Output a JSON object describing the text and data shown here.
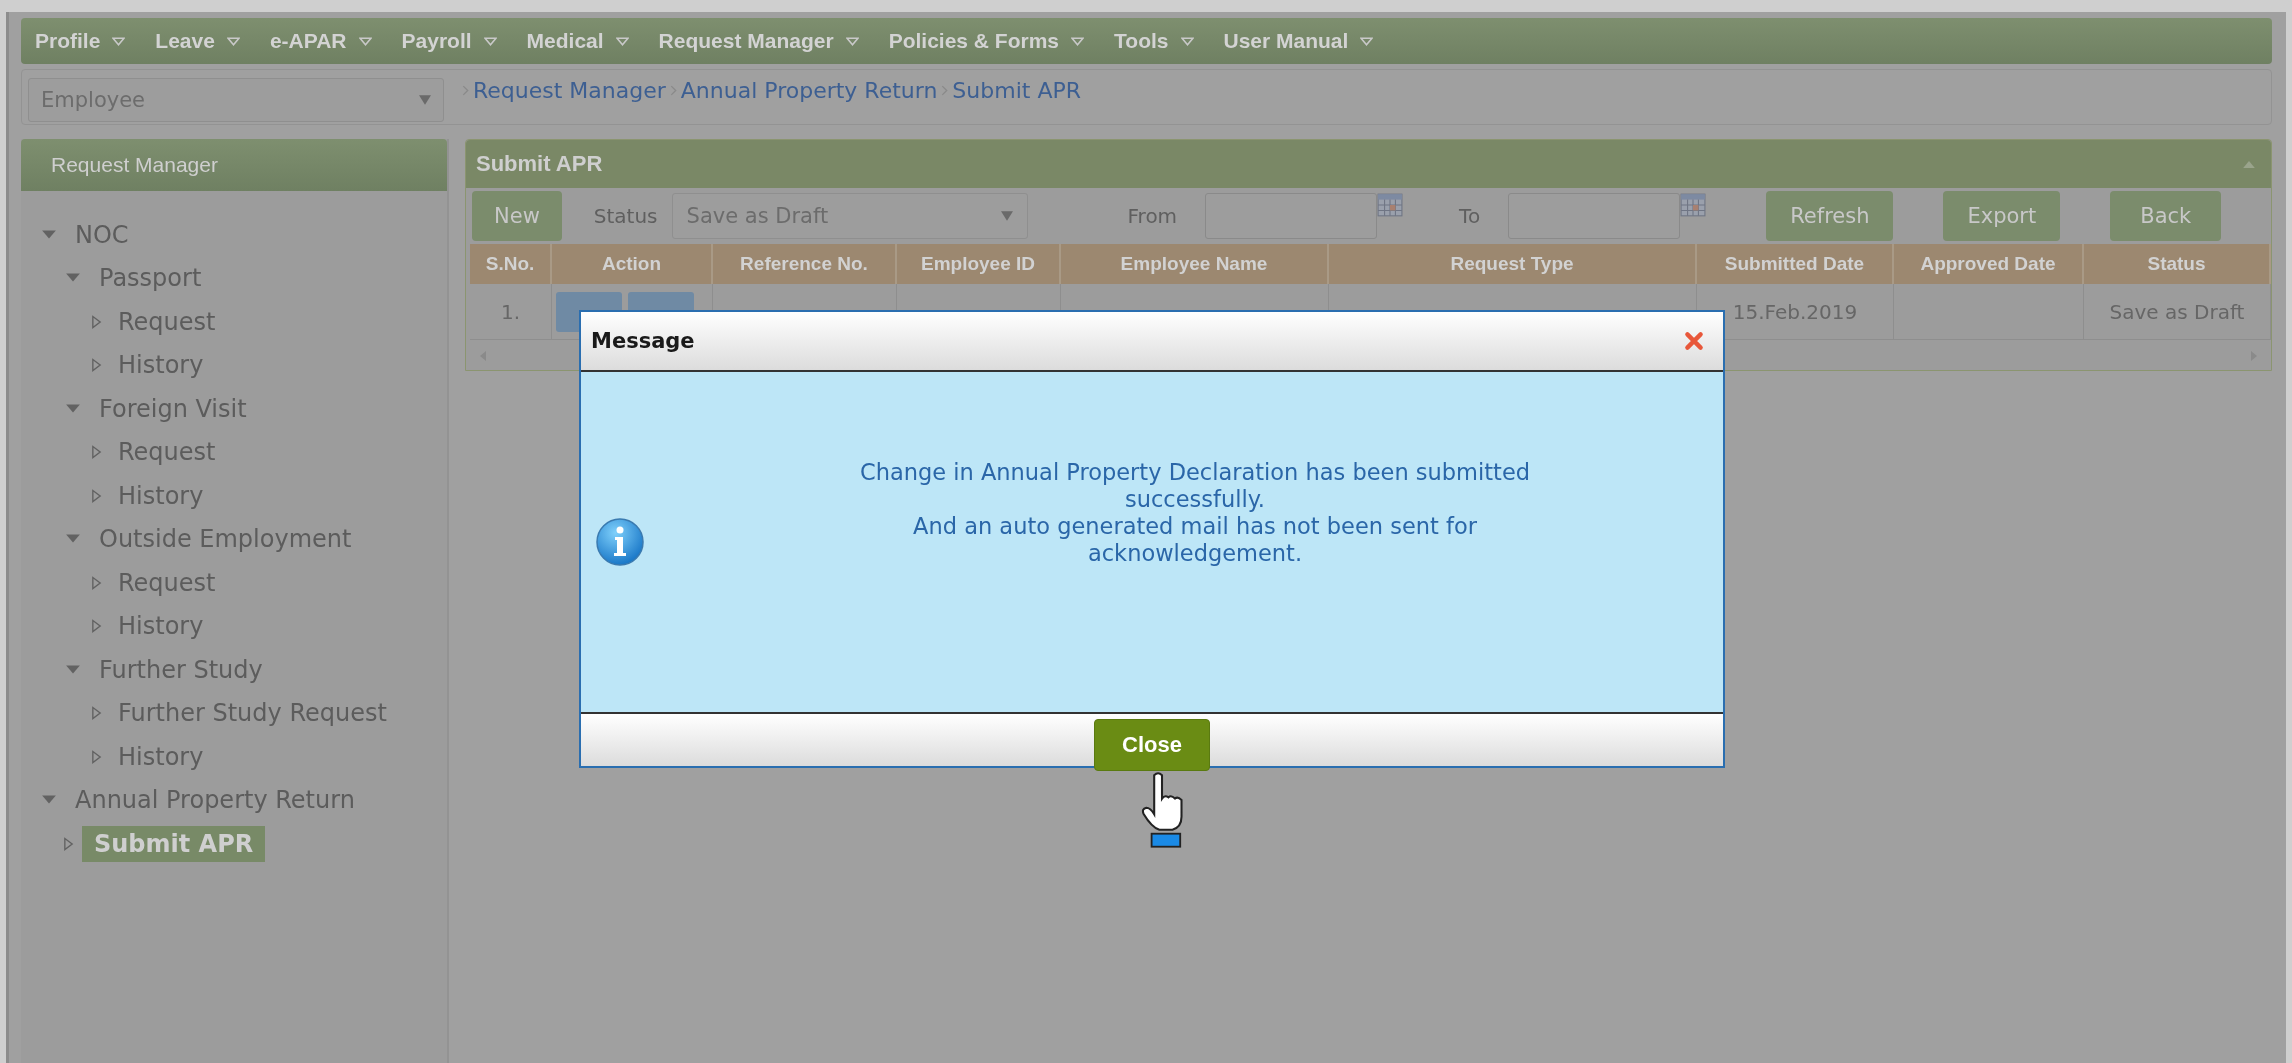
{
  "menu": [
    "Profile",
    "Leave",
    "e-APAR",
    "Payroll",
    "Medical",
    "Request Manager",
    "Policies & Forms",
    "Tools",
    "User Manual"
  ],
  "role_select": {
    "value": "Employee"
  },
  "breadcrumb": [
    "Request Manager",
    "Annual Property Return",
    "Submit APR"
  ],
  "sidebar": {
    "title": "Request Manager",
    "tree": [
      {
        "label": "NOC",
        "expanded": true,
        "children": [
          {
            "label": "Passport",
            "expanded": true,
            "children": [
              {
                "label": "Request",
                "selected": false
              },
              {
                "label": "History",
                "selected": false
              }
            ]
          },
          {
            "label": "Foreign Visit",
            "expanded": true,
            "children": [
              {
                "label": "Request",
                "selected": false
              },
              {
                "label": "History",
                "selected": false
              }
            ]
          },
          {
            "label": "Outside Employment",
            "expanded": true,
            "children": [
              {
                "label": "Request",
                "selected": false
              },
              {
                "label": "History",
                "selected": false
              }
            ]
          },
          {
            "label": "Further Study",
            "expanded": true,
            "children": [
              {
                "label": "Further Study Request",
                "selected": false
              },
              {
                "label": "History",
                "selected": false
              }
            ]
          }
        ]
      },
      {
        "label": "Annual Property Return",
        "expanded": true,
        "children": [
          {
            "label": "Submit APR",
            "selected": true
          }
        ]
      }
    ]
  },
  "panel": {
    "title": "Submit APR",
    "toolbar": {
      "new_button": "New",
      "status_label": "Status",
      "status_value": "Save as Draft",
      "from_label": "From",
      "to_label": "To",
      "buttons": [
        "Refresh",
        "Export",
        "Back"
      ]
    },
    "table": {
      "columns": [
        "S.No.",
        "Action",
        "Reference No.",
        "Employee ID",
        "Employee Name",
        "Request Type",
        "Submitted Date",
        "Approved Date",
        "Status"
      ],
      "rows": [
        {
          "sno": "1.",
          "submitted_date": "15.Feb.2019",
          "status": "Save as Draft"
        }
      ]
    }
  },
  "dialog": {
    "title": "Message",
    "lines": [
      "Change in Annual Property Declaration has been submitted successfully.",
      "And an auto generated mail has not been sent for acknowledgement."
    ],
    "button": "Close"
  }
}
